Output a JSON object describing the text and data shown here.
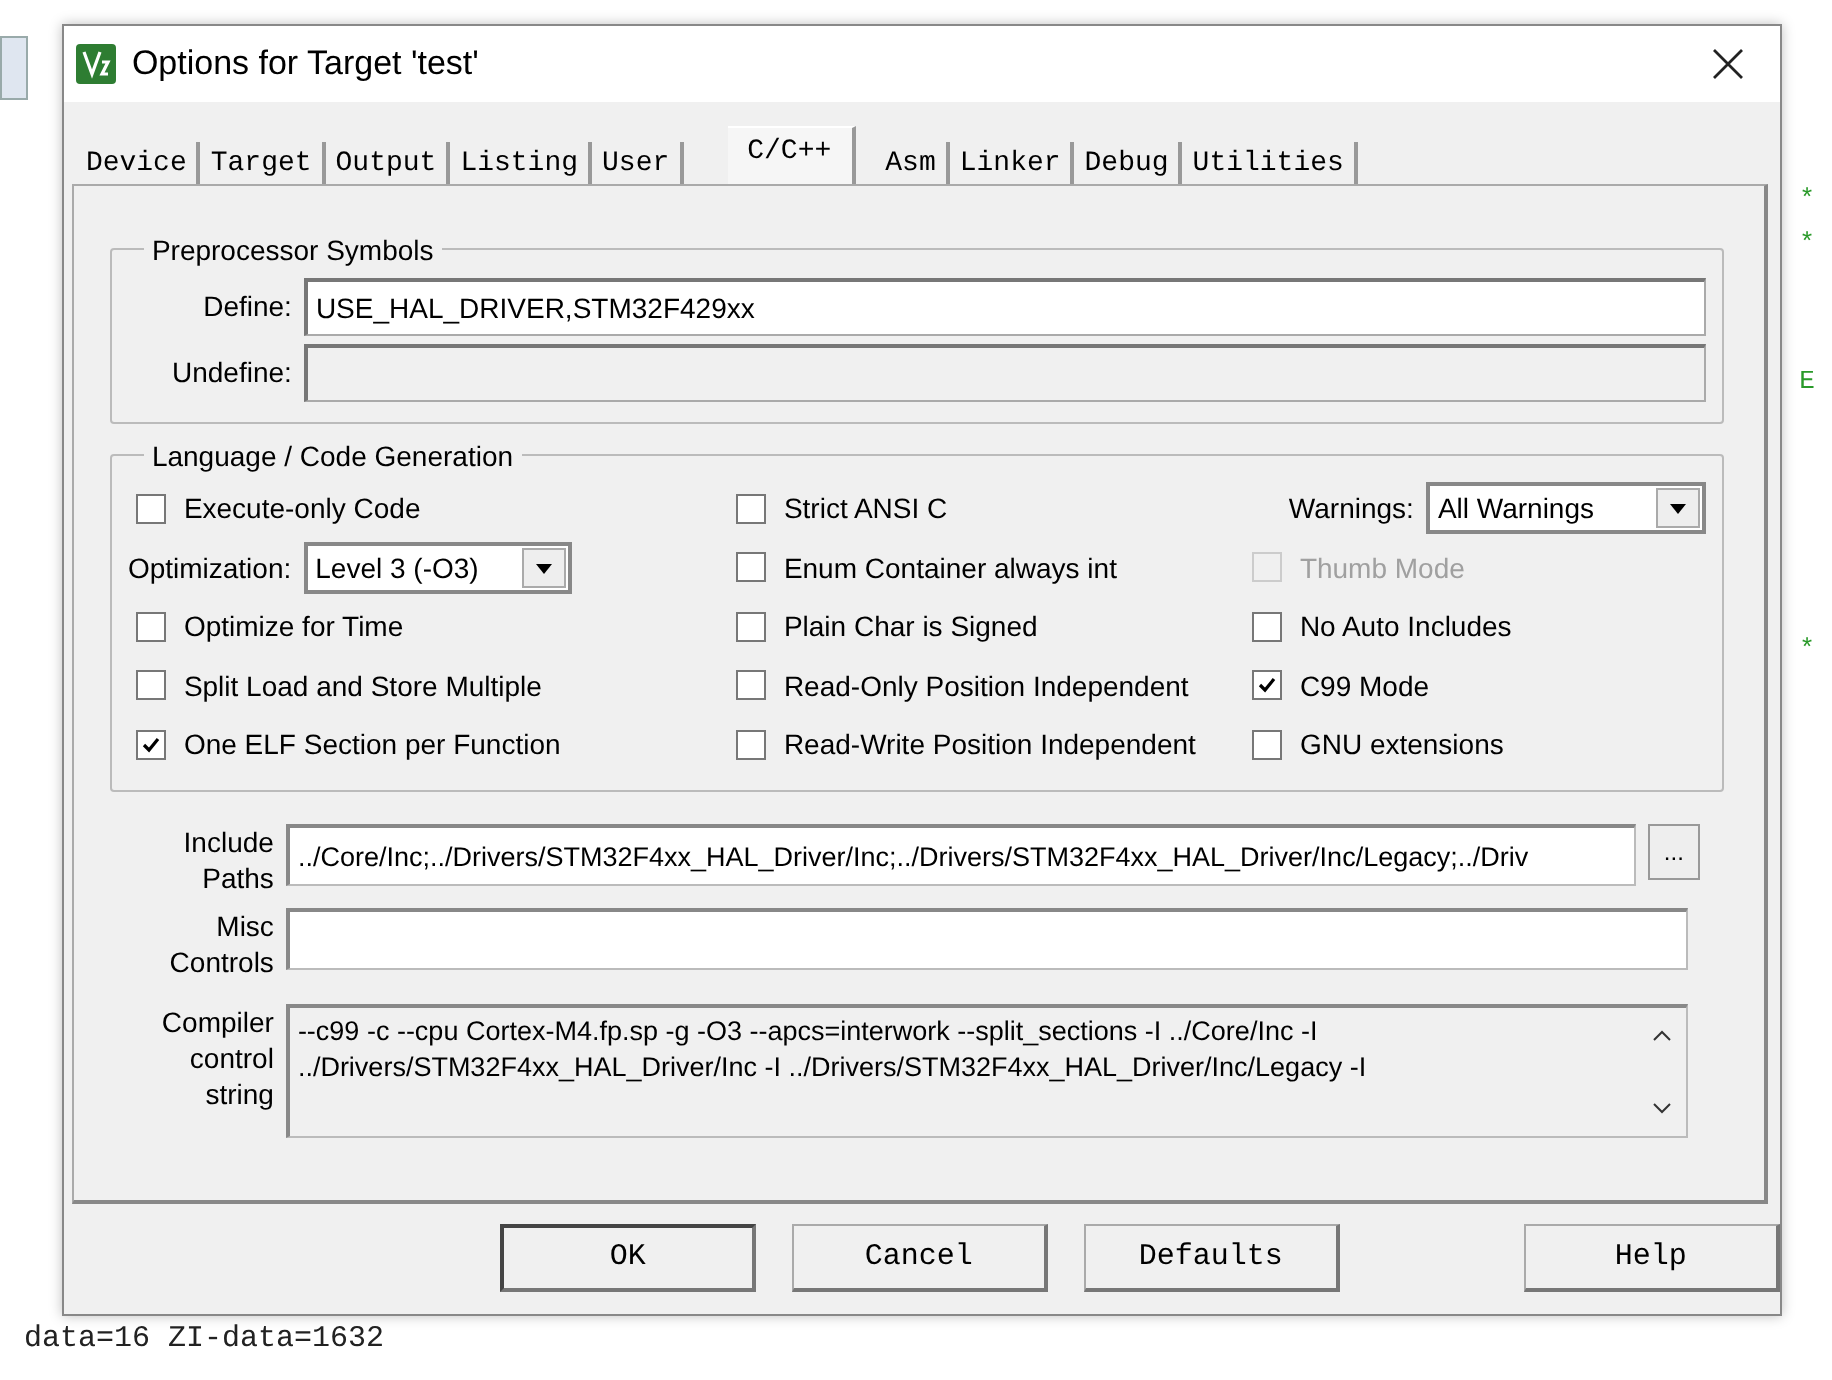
{
  "background": {
    "text": "data=16 ZI-data=1632",
    "marks": [
      "*",
      "*",
      "E",
      "*"
    ]
  },
  "window": {
    "title": "Options for Target 'test'"
  },
  "tabs": [
    {
      "label": "Device",
      "selected": false
    },
    {
      "label": "Target",
      "selected": false
    },
    {
      "label": "Output",
      "selected": false
    },
    {
      "label": "Listing",
      "selected": false
    },
    {
      "label": "User",
      "selected": false
    },
    {
      "label": "C/C++",
      "selected": true
    },
    {
      "label": "Asm",
      "selected": false
    },
    {
      "label": "Linker",
      "selected": false
    },
    {
      "label": "Debug",
      "selected": false
    },
    {
      "label": "Utilities",
      "selected": false
    }
  ],
  "preprocessor": {
    "title": "Preprocessor Symbols",
    "fields": [
      {
        "label": "Define:",
        "value": "USE_HAL_DRIVER,STM32F429xx",
        "disabled": false
      },
      {
        "label": "Undefine:",
        "disabled": true
      }
    ]
  },
  "language": {
    "title": "Language / Code Generation",
    "columns": [
      [
        {
          "kind": "checkbox",
          "label": "Execute-only Code",
          "checked": false,
          "disabled": false
        },
        {
          "kind": "select",
          "label": "Optimization:",
          "value": "Level 3 (-O3)"
        },
        {
          "kind": "checkbox",
          "label": "Optimize for Time",
          "checked": false,
          "disabled": false
        },
        {
          "kind": "checkbox",
          "label": "Split Load and Store Multiple",
          "checked": false,
          "disabled": false
        },
        {
          "kind": "checkbox",
          "label": "One ELF Section per Function",
          "checked": true,
          "disabled": false
        }
      ],
      [
        {
          "kind": "checkbox",
          "label": "Strict ANSI C",
          "checked": false,
          "disabled": false
        },
        {
          "kind": "checkbox",
          "label": "Enum Container always int",
          "checked": false,
          "disabled": false
        },
        {
          "kind": "checkbox",
          "label": "Plain Char is Signed",
          "checked": false,
          "disabled": false
        },
        {
          "kind": "checkbox",
          "label": "Read-Only Position Independent",
          "checked": false,
          "disabled": false
        },
        {
          "kind": "checkbox",
          "label": "Read-Write Position Independent",
          "checked": false,
          "disabled": false
        }
      ],
      [
        {
          "kind": "select",
          "label": "Warnings:",
          "value": "All Warnings"
        },
        {
          "kind": "checkbox",
          "label": "Thumb Mode",
          "checked": false,
          "disabled": true
        },
        {
          "kind": "checkbox",
          "label": "No Auto Includes",
          "checked": false,
          "disabled": false
        },
        {
          "kind": "checkbox",
          "label": "C99 Mode",
          "checked": true,
          "disabled": false
        },
        {
          "kind": "checkbox",
          "label": "GNU extensions",
          "checked": false,
          "disabled": false
        }
      ]
    ]
  },
  "fields": [
    {
      "kind": "browse",
      "label": [
        "Include",
        "Paths"
      ],
      "value": "../Core/Inc;../Drivers/STM32F4xx_HAL_Driver/Inc;../Drivers/STM32F4xx_HAL_Driver/Inc/Legacy;../Driv",
      "button": "..."
    },
    {
      "kind": "text",
      "label": [
        "Misc",
        "Controls"
      ]
    },
    {
      "kind": "readonly",
      "label": [
        "Compiler",
        "control",
        "string"
      ],
      "lines": [
        "--c99 -c --cpu Cortex-M4.fp.sp -g -O3 --apcs=interwork --split_sections -I ../Core/Inc -I",
        "../Drivers/STM32F4xx_HAL_Driver/Inc -I ../Drivers/STM32F4xx_HAL_Driver/Inc/Legacy -I"
      ]
    }
  ],
  "buttons": [
    "OK",
    "Cancel",
    "Defaults",
    "Help"
  ]
}
